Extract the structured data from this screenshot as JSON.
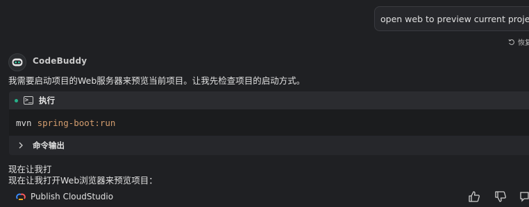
{
  "user_message": "open web to preview current project",
  "restore_label": "恢复",
  "agent": {
    "name": "CodeBuddy"
  },
  "intro_text": "我需要启动项目的Web服务器来预览当前项目。让我先检查项目的启动方式。",
  "exec": {
    "title": "执行",
    "command": "mvn",
    "args": "spring-boot:run",
    "output_label": "命令输出"
  },
  "followups": [
    "现在让我打",
    "现在让我打开Web浏览器来预览项目："
  ],
  "publish_label": "Publish CloudStudio",
  "colors": {
    "accent_green": "#27b28b",
    "code_arg": "#d59e6f",
    "background": "#1f2023"
  }
}
